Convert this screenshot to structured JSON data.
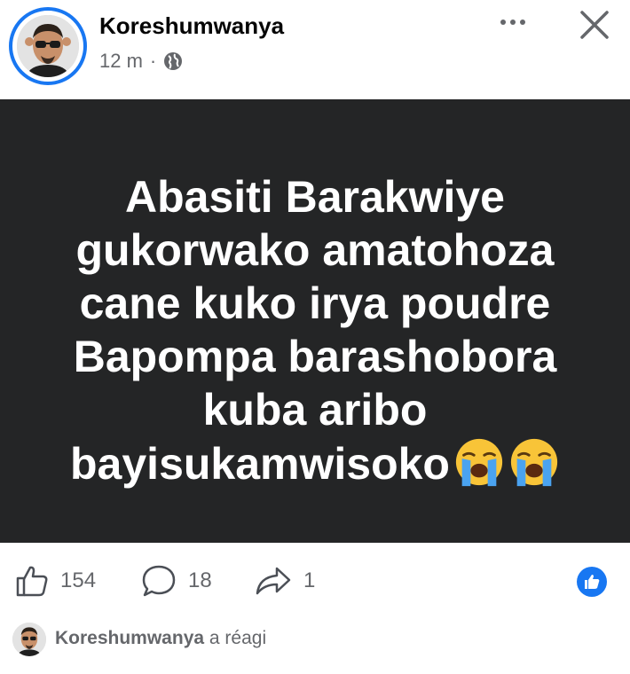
{
  "post": {
    "author": "Koreshumwanya",
    "time": "12 m",
    "separator": "·",
    "text": "Abasiti Barakwiye gukorwako amatohoza cane kuko irya poudre Bapompa barashobora kuba aribo bayisukamwisoko",
    "emoji": [
      "loudly-crying-face-icon",
      "loudly-crying-face-icon"
    ],
    "background_color": "#242526",
    "text_color": "#ffffff"
  },
  "actions": {
    "likes": "154",
    "comments": "18",
    "shares": "1"
  },
  "reaction": {
    "name": "Koreshumwanya",
    "text": "a réagi"
  },
  "colors": {
    "accent": "#1877f2",
    "secondary_text": "#65676b"
  }
}
